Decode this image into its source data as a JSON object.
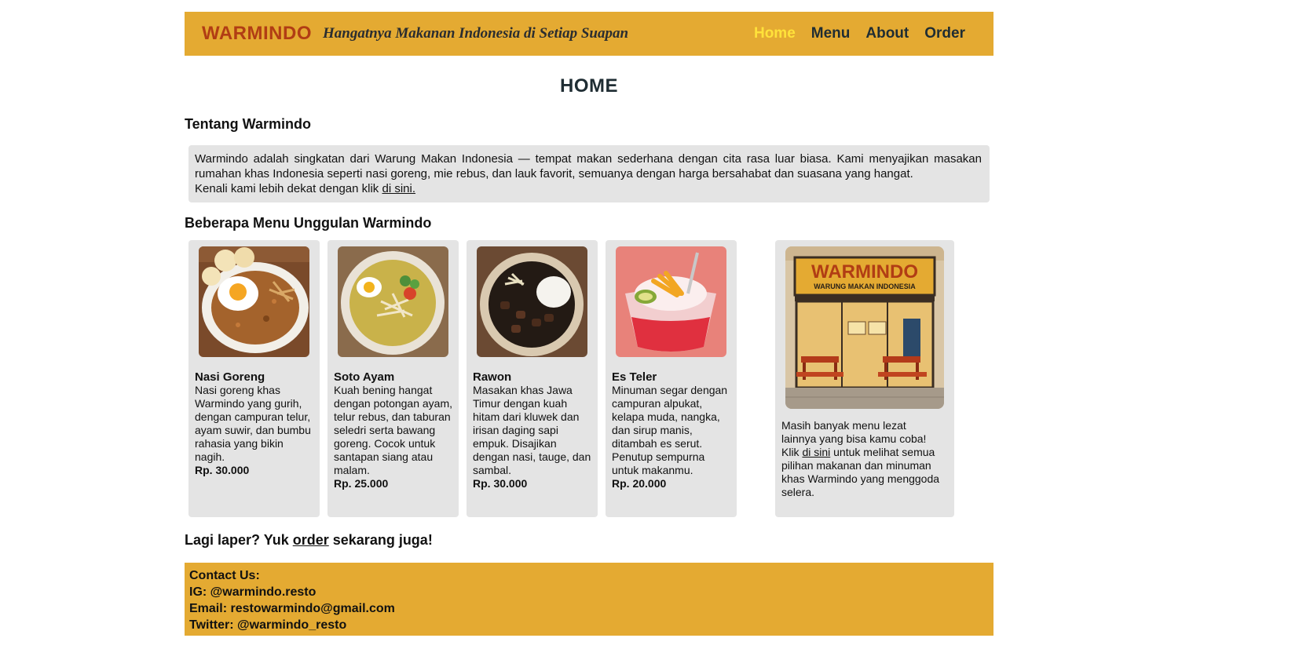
{
  "header": {
    "brand": "WARMINDO",
    "tagline": "Hangatnya Makanan Indonesia di Setiap Suapan",
    "nav": [
      {
        "label": "Home",
        "active": true
      },
      {
        "label": "Menu",
        "active": false
      },
      {
        "label": "About",
        "active": false
      },
      {
        "label": "Order",
        "active": false
      }
    ]
  },
  "page_title": "HOME",
  "about": {
    "heading": "Tentang Warmindo",
    "text": "Warmindo adalah singkatan dari Warung Makan Indonesia — tempat makan sederhana dengan cita rasa luar biasa. Kami menyajikan masakan rumahan khas Indonesia seperti nasi goreng, mie rebus, dan lauk favorit, semuanya dengan harga bersahabat dan suasana yang hangat.",
    "more_prefix": "Kenali kami lebih dekat dengan klik",
    "more_link": "di sini."
  },
  "menu_section": {
    "heading": "Beberapa Menu Unggulan Warmindo",
    "items": [
      {
        "name": "Nasi Goreng",
        "icon": "nasi-goreng-image",
        "description": "Nasi goreng khas Warmindo yang gurih, dengan campuran telur, ayam suwir, dan bumbu rahasia yang bikin nagih.",
        "price": "Rp. 30.000"
      },
      {
        "name": "Soto Ayam",
        "icon": "soto-ayam-image",
        "description": "Kuah bening hangat dengan potongan ayam, telur rebus, dan taburan seledri serta bawang goreng. Cocok untuk santapan siang atau malam.",
        "price": "Rp. 25.000"
      },
      {
        "name": "Rawon",
        "icon": "rawon-image",
        "description": "Masakan khas Jawa Timur dengan kuah hitam dari kluwek dan irisan daging sapi empuk. Disajikan dengan nasi, tauge, dan sambal.",
        "price": "Rp. 30.000"
      },
      {
        "name": "Es Teler",
        "icon": "es-teler-image",
        "description": "Minuman segar dengan campuran alpukat, kelapa muda, nangka, dan sirup manis, ditambah es serut. Penutup sempurna untuk makanmu.",
        "price": "Rp. 20.000"
      }
    ],
    "promo": {
      "sign_title": "WARMINDO",
      "sign_subtitle": "WARUNG MAKAN INDONESIA",
      "text_before": "Masih banyak menu lezat lainnya yang bisa kamu coba! Klik",
      "link": "di sini",
      "text_after": "untuk melihat semua pilihan makanan dan minuman khas Warmindo yang menggoda selera."
    }
  },
  "cta": {
    "prefix": "Lagi laper? Yuk",
    "link": "order",
    "suffix": "sekarang juga!"
  },
  "footer": {
    "title": "Contact Us:",
    "ig": "IG: @warmindo.resto",
    "email": "Email: restowarmindo@gmail.com",
    "twitter": "Twitter: @warmindo_resto"
  },
  "colors": {
    "accent": "#e4aa32",
    "brand": "#b13d14",
    "nav_active": "#ffe23a",
    "card_bg": "#e4e4e4"
  }
}
